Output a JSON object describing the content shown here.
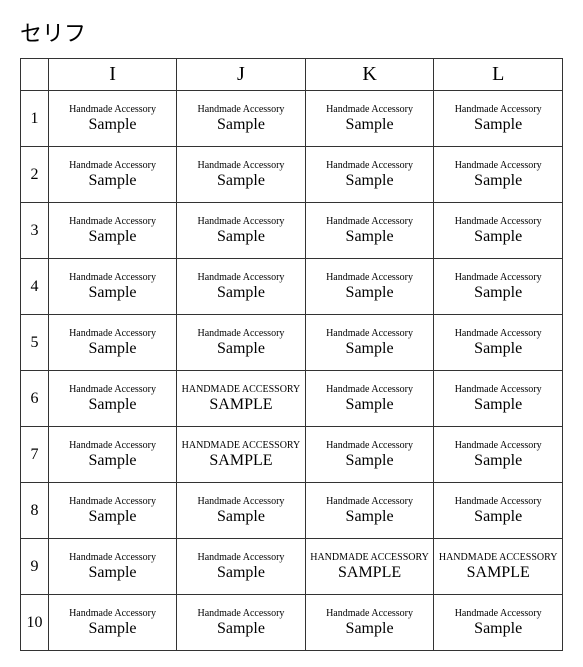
{
  "title": "セリフ",
  "columns": [
    "I",
    "J",
    "K",
    "L"
  ],
  "top_label": "Handmade Accessory",
  "main_label": "Sample",
  "rows": [
    {
      "num": "1",
      "cells": [
        "s1i",
        "s1j",
        "s1k",
        "s1l"
      ]
    },
    {
      "num": "2",
      "cells": [
        "s2i",
        "s2j",
        "s2k",
        "s2l"
      ]
    },
    {
      "num": "3",
      "cells": [
        "s3i",
        "s3j",
        "s3k",
        "s3l"
      ]
    },
    {
      "num": "4",
      "cells": [
        "s4i",
        "s4j",
        "s4k",
        "s4l"
      ]
    },
    {
      "num": "5",
      "cells": [
        "s5i",
        "s5j",
        "s5k",
        "s5l"
      ]
    },
    {
      "num": "6",
      "cells": [
        "s6i",
        "s6j",
        "s6k",
        "s6l"
      ]
    },
    {
      "num": "7",
      "cells": [
        "s7i",
        "s7j",
        "s7k",
        "s7l"
      ]
    },
    {
      "num": "8",
      "cells": [
        "s8i",
        "s8j",
        "s8k",
        "s8l"
      ]
    },
    {
      "num": "9",
      "cells": [
        "s9i",
        "s9j",
        "s9k",
        "s9l"
      ]
    },
    {
      "num": "10",
      "cells": [
        "s10i",
        "s10j",
        "s10k",
        "s10l"
      ]
    }
  ],
  "cell_top_texts": {
    "s6j": "HANDMADE ACCESSORY",
    "s7j": "HANDMADE ACCESSORY",
    "s9k": "HANDMADE ACCESSORY",
    "s9l": "HANDMADE ACCESSORY"
  },
  "cell_main_texts": {
    "s6j": "SAMPLE",
    "s7j": "SAMPLE",
    "s9k": "SAMPLE",
    "s9l": "SAMPLE"
  }
}
